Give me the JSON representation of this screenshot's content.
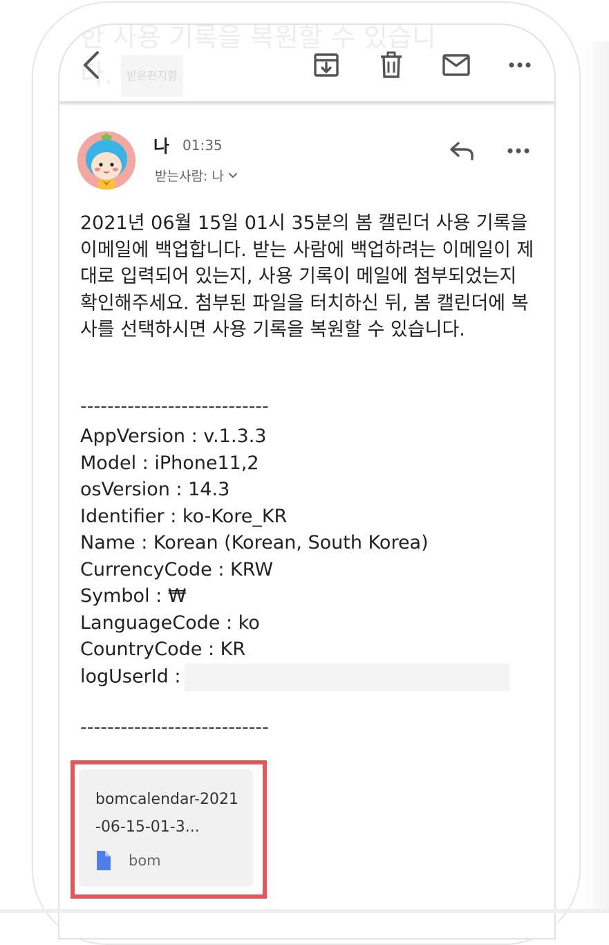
{
  "toolbar": {
    "ghost_subject": "한 사용 기록을 복원할 수 있습니다.",
    "ghost_badge": "받은편지함"
  },
  "header": {
    "sender": "나",
    "time": "01:35",
    "recipient": "받는사람: 나"
  },
  "body": {
    "paragraph": "2021년 06월 15일 01시 35분의 봄 캘린더 사용 기록을 이메일에 백업합니다. 받는 사람에 백업하려는 이메일이 제대로 입력되어 있는지, 사용 기록이 메일에 첨부되었는지 확인해주세요. 첨부된 파일을 터치하신 뒤, 봄 캘린더에 복사를 선택하시면 사용 기록을 복원할 수 있습니다.",
    "separator": "----------------------------",
    "info": [
      "AppVersion : v.1.3.3",
      "Model : iPhone11,2",
      "osVersion : 14.3",
      "Identifier : ko-Kore_KR",
      "Name : Korean (Korean, South Korea)",
      "CurrencyCode : KRW",
      "Symbol : ₩",
      "LanguageCode : ko",
      "CountryCode : KR",
      "logUserId :"
    ]
  },
  "attachment": {
    "filename": "bomcalendar-2021-06-15-01-3...",
    "type": "bom"
  },
  "colors": {
    "highlight": "#e5575a",
    "file_icon": "#4e7ee8",
    "avatar_bg": "#f3a7a0"
  }
}
